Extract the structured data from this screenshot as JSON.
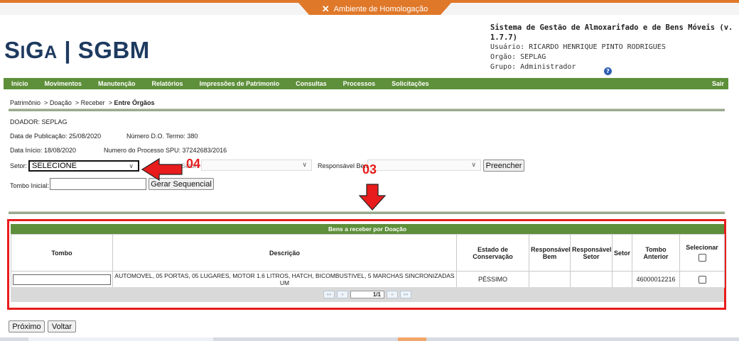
{
  "environment": {
    "label": "Ambiente de Homologação",
    "icon": "tools-icon",
    "color": "#e0782a"
  },
  "brand": {
    "logo_text": "SiGA | SGBM"
  },
  "system_info": {
    "title": "Sistema de Gestão de Almoxarifado e de Bens Móveis (v. 1.7.7)",
    "user": "Usuário: RICARDO HENRIQUE PINTO RODRIGUES",
    "org": "Orgão: SEPLAG",
    "group": "Grupo: Administrador"
  },
  "menu": {
    "items": [
      "Início",
      "Movimentos",
      "Manutenção",
      "Relatórios",
      "Impressões de Patrimonio",
      "Consultas",
      "Processos",
      "Solicitações"
    ],
    "exit_label": "Sair",
    "color": "#5e8f3a"
  },
  "breadcrumb": {
    "items": [
      "Patrimônio",
      "Doação",
      "Receber"
    ],
    "separator": ">",
    "current": "Entre Órgãos"
  },
  "form": {
    "doador": "DOADOR: SEPLAG",
    "data_publicacao": "Data de Publicação: 25/08/2020",
    "numero_termo": "Número D.O. Termo: 380",
    "data_inicio": "Data Início: 18/08/2020",
    "numero_processo": "Numero do Processo SPU: 37242683/2016",
    "setor_label": "Setor:",
    "setor_value": "SELECIONE",
    "setor2_label": "Setor:",
    "responsavel_label": "Responsável Bem:",
    "fill_button": "Preencher",
    "tombo_inicial_label": "Tombo Inicial:",
    "tombo_inicial_value": "",
    "generate_button": "Gerar Sequencial"
  },
  "annotations": {
    "label_04": "04",
    "label_03": "03",
    "color": "#e81c1c"
  },
  "table": {
    "title": "Bens a receber por Doação",
    "columns": [
      "Tombo",
      "Descrição",
      "Estado de Conservação",
      "Responsável Bem",
      "Responsável Setor",
      "Setor",
      "Tombo Anterior",
      "Selecionar"
    ],
    "rows": [
      {
        "tombo": "",
        "descricao": "AUTOMOVEL, 05 PORTAS, 05 LUGARES, MOTOR 1.6 LITROS, HATCH, BICOMBUSTIVEL, 5 MARCHAS SINCRONIZADAS UM",
        "estado": "PÉSSIMO",
        "resp_bem": "",
        "resp_setor": "",
        "setor": "",
        "tombo_anterior": "46000012216",
        "selecionado": false
      }
    ]
  },
  "pagination": {
    "first": "««",
    "prev": "«",
    "page": "1/1",
    "next": "»",
    "last": "»»"
  },
  "footer": {
    "next_button": "Próximo",
    "back_button": "Voltar"
  }
}
